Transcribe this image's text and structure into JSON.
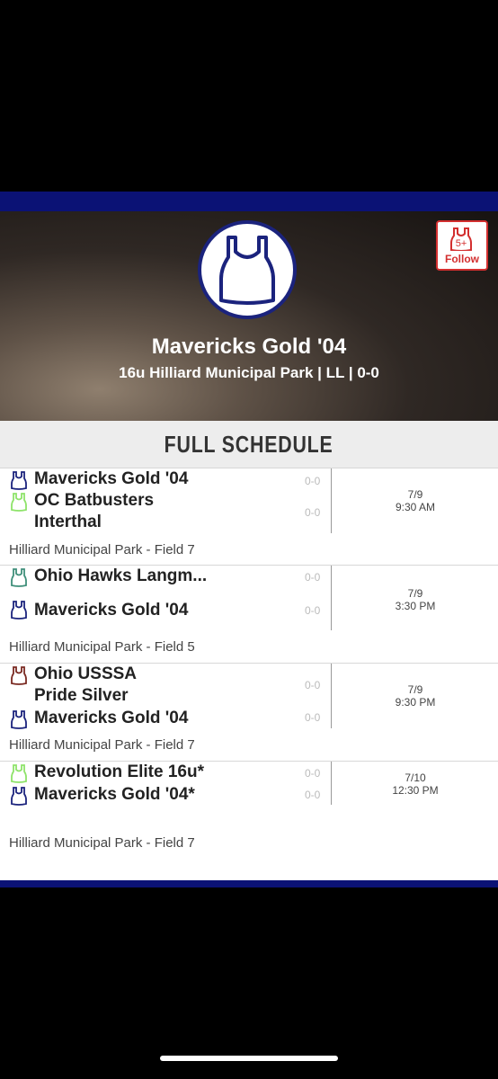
{
  "team": {
    "name": "Mavericks Gold '04",
    "subtitle": "16u Hilliard Municipal Park | LL | 0-0",
    "follow_count": "5+",
    "follow_label": "Follow"
  },
  "schedule": {
    "title": "FULL SCHEDULE",
    "games": [
      {
        "team1": "Mavericks Gold '04",
        "team1_color": "#1b237d",
        "team1_score": "0-0",
        "team2": "OC Batbusters Interthal",
        "team2_color": "#8ee36a",
        "team2_score": "0-0",
        "date": "7/9",
        "time": "9:30 AM",
        "location": "Hilliard Municipal Park - Field 7"
      },
      {
        "team1": "Ohio Hawks Langm...",
        "team1_color": "#3f8f7a",
        "team1_score": "0-0",
        "team2": "Mavericks Gold '04",
        "team2_color": "#1b237d",
        "team2_score": "0-0",
        "date": "7/9",
        "time": "3:30 PM",
        "location": "Hilliard Municipal Park - Field 5"
      },
      {
        "team1": "Ohio USSSA Pride Silver",
        "team1_color": "#7a2a22",
        "team1_score": "0-0",
        "team2": "Mavericks Gold '04",
        "team2_color": "#1b237d",
        "team2_score": "0-0",
        "date": "7/9",
        "time": "9:30 PM",
        "location": "Hilliard Municipal Park - Field 7"
      },
      {
        "team1": "Revolution Elite 16u*",
        "team1_color": "#8ee36a",
        "team1_score": "0-0",
        "team2": "Mavericks Gold '04*",
        "team2_color": "#1b237d",
        "team2_score": "0-0",
        "date": "7/10",
        "time": "12:30 PM",
        "location": "Hilliard Municipal Park - Field 7"
      }
    ]
  },
  "colors": {
    "navy": "#0b1275",
    "follow_red": "#d32f2f"
  }
}
